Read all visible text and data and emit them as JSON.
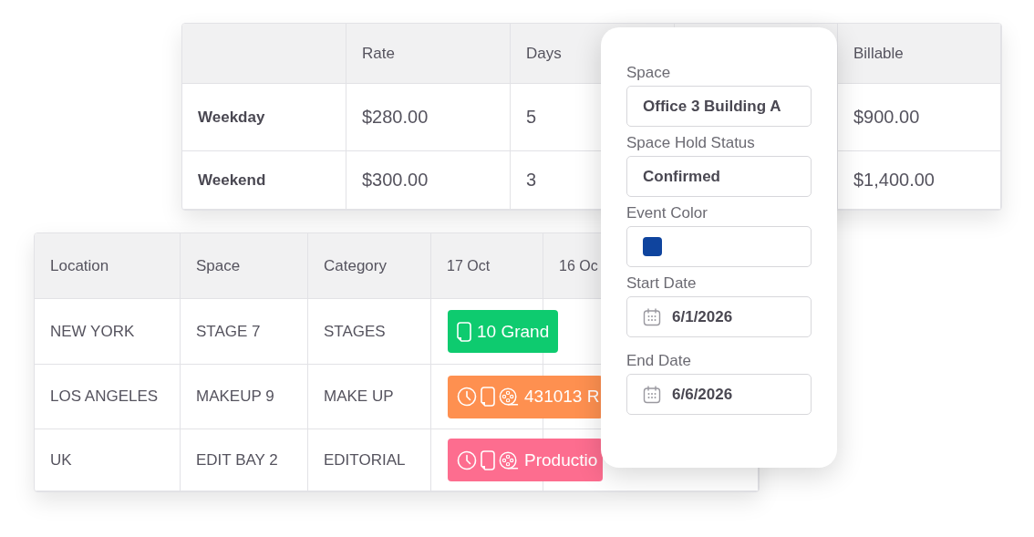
{
  "rates_table": {
    "headers": {
      "rate": "Rate",
      "days": "Days",
      "billable": "Billable"
    },
    "rows": [
      {
        "name": "Weekday",
        "rate": "$280.00",
        "days": "5",
        "billable": "$900.00"
      },
      {
        "name": "Weekend",
        "rate": "$300.00",
        "days": "3",
        "billable": "$1,400.00"
      }
    ]
  },
  "bookings_table": {
    "columns": [
      "Location",
      "Space",
      "Category",
      "17 Oct",
      "16 Oc"
    ],
    "rows": [
      {
        "location": "NEW YORK",
        "space": "STAGE 7",
        "category": "STAGES",
        "event": {
          "kind": "device",
          "label": "10 Grand",
          "color": "#0ecb6f"
        }
      },
      {
        "location": "LOS ANGELES",
        "space": "MAKEUP 9",
        "category": "MAKE UP",
        "event": {
          "kind": "scheduled",
          "label": "431013 R",
          "color": "#fe9050"
        }
      },
      {
        "location": "UK",
        "space": "EDIT BAY 2",
        "category": "EDITORIAL",
        "event": {
          "kind": "scheduled",
          "label": "Productio",
          "color": "#fd6d8f"
        }
      }
    ]
  },
  "event_form": {
    "fields": [
      {
        "kind": "text",
        "label": "Space",
        "value": "Office 3 Building A"
      },
      {
        "kind": "text",
        "label": "Space Hold Status",
        "value": "Confirmed"
      },
      {
        "kind": "color",
        "label": "Event Color",
        "color": "#0f449e"
      },
      {
        "kind": "date",
        "label": "Start Date",
        "value": "6/1/2026"
      },
      {
        "kind": "date",
        "label": "End Date",
        "value": "6/6/2026"
      }
    ]
  }
}
